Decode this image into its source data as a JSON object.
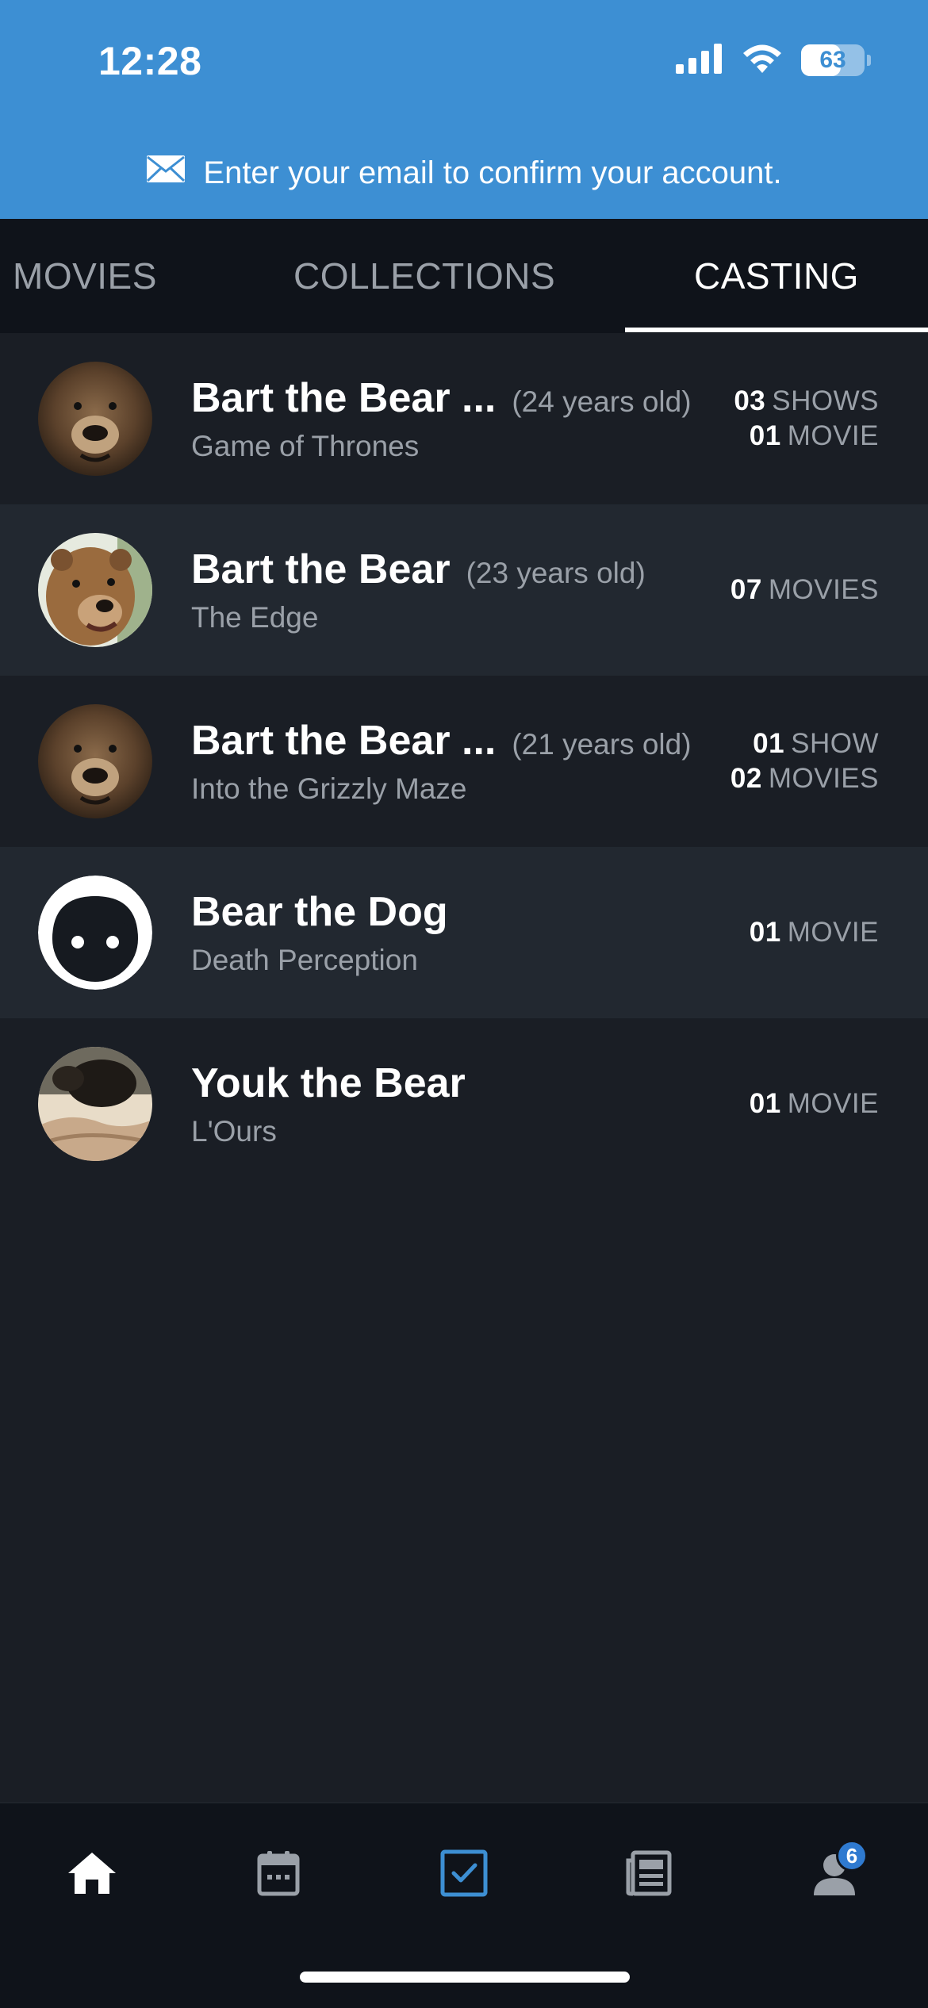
{
  "status_bar": {
    "time": "12:28",
    "battery": "63",
    "battery_level": 0.63
  },
  "banner": {
    "icon": "mail-icon",
    "text": "Enter your email to confirm your account."
  },
  "tabs": [
    {
      "label": "MOVIES",
      "active": false
    },
    {
      "label": "COLLECTIONS",
      "active": false
    },
    {
      "label": "CASTING",
      "active": true
    }
  ],
  "cast": [
    {
      "name": "Bart the Bear ...",
      "age": "(24 years old)",
      "subtitle": "Game of Thrones",
      "counts": [
        {
          "num": "03",
          "label": "SHOWS"
        },
        {
          "num": "01",
          "label": "MOVIE"
        }
      ],
      "avatar": "bear-photo"
    },
    {
      "name": "Bart the Bear",
      "age": "(23 years old)",
      "subtitle": "The Edge",
      "counts": [
        {
          "num": "07",
          "label": "MOVIES"
        }
      ],
      "avatar": "bear-photo"
    },
    {
      "name": "Bart the Bear ...",
      "age": "(21 years old)",
      "subtitle": "Into the Grizzly Maze",
      "counts": [
        {
          "num": "01",
          "label": "SHOW"
        },
        {
          "num": "02",
          "label": "MOVIES"
        }
      ],
      "avatar": "bear-photo"
    },
    {
      "name": "Bear the Dog",
      "age": "",
      "subtitle": "Death Perception",
      "counts": [
        {
          "num": "01",
          "label": "MOVIE"
        }
      ],
      "avatar": "default-person-icon"
    },
    {
      "name": "Youk the Bear",
      "age": "",
      "subtitle": "L'Ours",
      "counts": [
        {
          "num": "01",
          "label": "MOVIE"
        }
      ],
      "avatar": "bear-photo"
    }
  ],
  "bottom_nav": {
    "items": [
      {
        "icon": "home-icon",
        "active": false
      },
      {
        "icon": "calendar-icon",
        "active": false
      },
      {
        "icon": "checkbox-icon",
        "active": true
      },
      {
        "icon": "news-icon",
        "active": false
      },
      {
        "icon": "profile-icon",
        "active": false,
        "badge": "6"
      }
    ]
  },
  "colors": {
    "header": "#3d8fd3",
    "background": "#1a1e25",
    "accent": "#3d8fd3"
  }
}
